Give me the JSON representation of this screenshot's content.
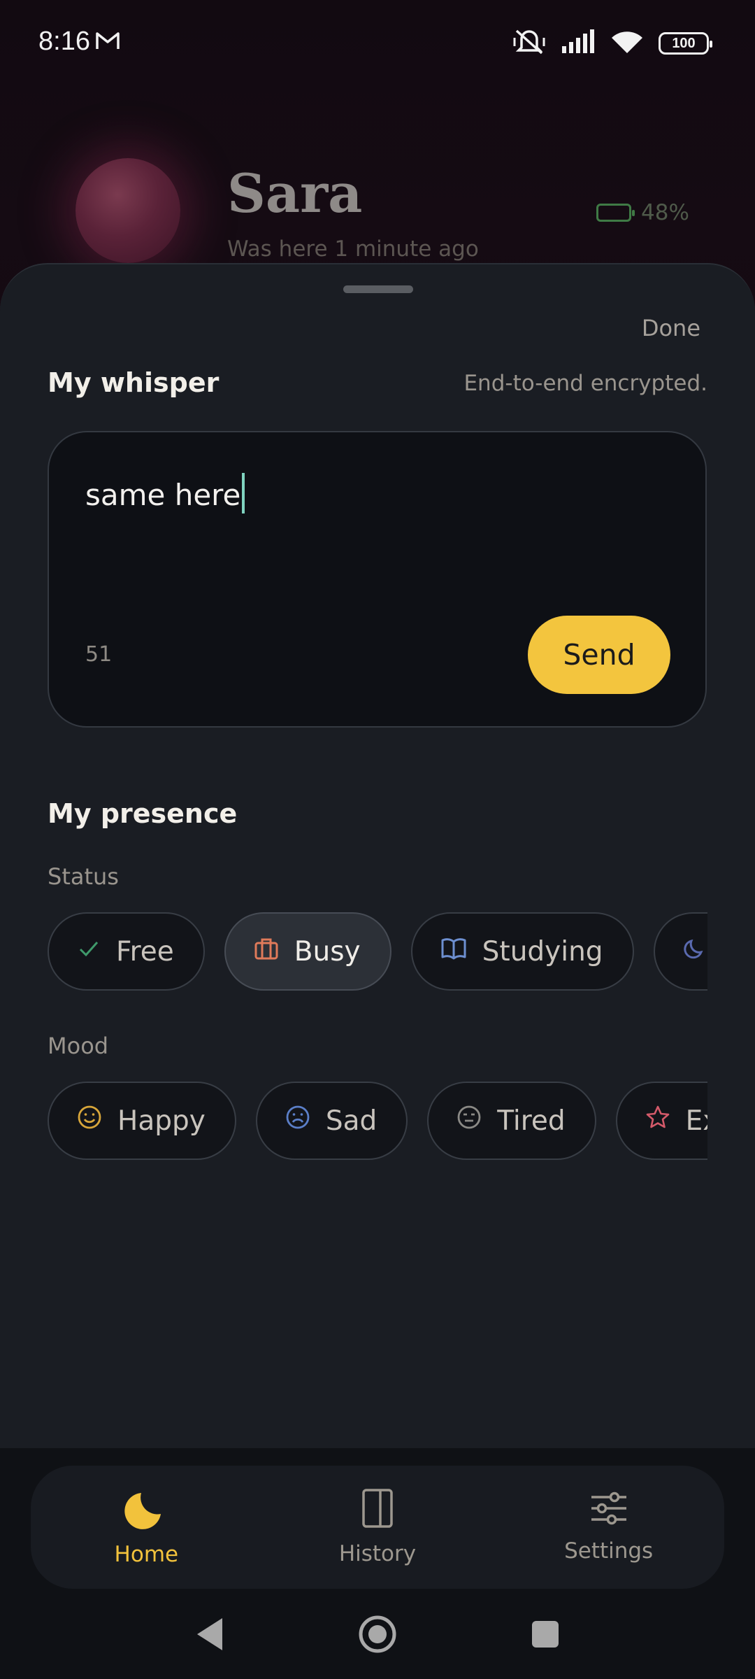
{
  "status_bar": {
    "time": "8:16",
    "battery": "100"
  },
  "partner": {
    "name": "Sara",
    "last_seen": "Was here 1 minute ago",
    "battery_percent": "48%",
    "battery_level": 0.48
  },
  "sheet": {
    "done_label": "Done",
    "whisper": {
      "title": "My whisper",
      "encryption_note": "End-to-end encrypted.",
      "input_value": "same here",
      "char_count": "51",
      "send_label": "Send"
    },
    "presence": {
      "title": "My presence",
      "status_label": "Status",
      "status_options": [
        {
          "label": "Free",
          "icon": "check-icon",
          "selected": false
        },
        {
          "label": "Busy",
          "icon": "briefcase-icon",
          "selected": true
        },
        {
          "label": "Studying",
          "icon": "book-icon",
          "selected": false
        },
        {
          "label": "",
          "icon": "moon-icon",
          "selected": false
        }
      ],
      "mood_label": "Mood",
      "mood_options": [
        {
          "label": "Happy",
          "icon": "smile-icon"
        },
        {
          "label": "Sad",
          "icon": "frown-icon"
        },
        {
          "label": "Tired",
          "icon": "meh-icon"
        },
        {
          "label": "Ex",
          "icon": "star-icon"
        }
      ]
    }
  },
  "bottom_nav": {
    "items": [
      {
        "label": "Home",
        "icon": "moon-icon",
        "active": true
      },
      {
        "label": "History",
        "icon": "book-icon",
        "active": false
      },
      {
        "label": "Settings",
        "icon": "sliders-icon",
        "active": false
      }
    ]
  },
  "colors": {
    "accent": "#f3c53e",
    "sheet_bg": "#1a1d23",
    "caret": "#7fd3c0",
    "free_icon": "#3f9a6b",
    "busy_icon": "#e07a5a",
    "studying_icon": "#6d8fd0",
    "happy_icon": "#d8a63a",
    "sad_icon": "#5b7fc8",
    "tired_icon": "#8b8a86",
    "excited_icon": "#d45a6a"
  }
}
